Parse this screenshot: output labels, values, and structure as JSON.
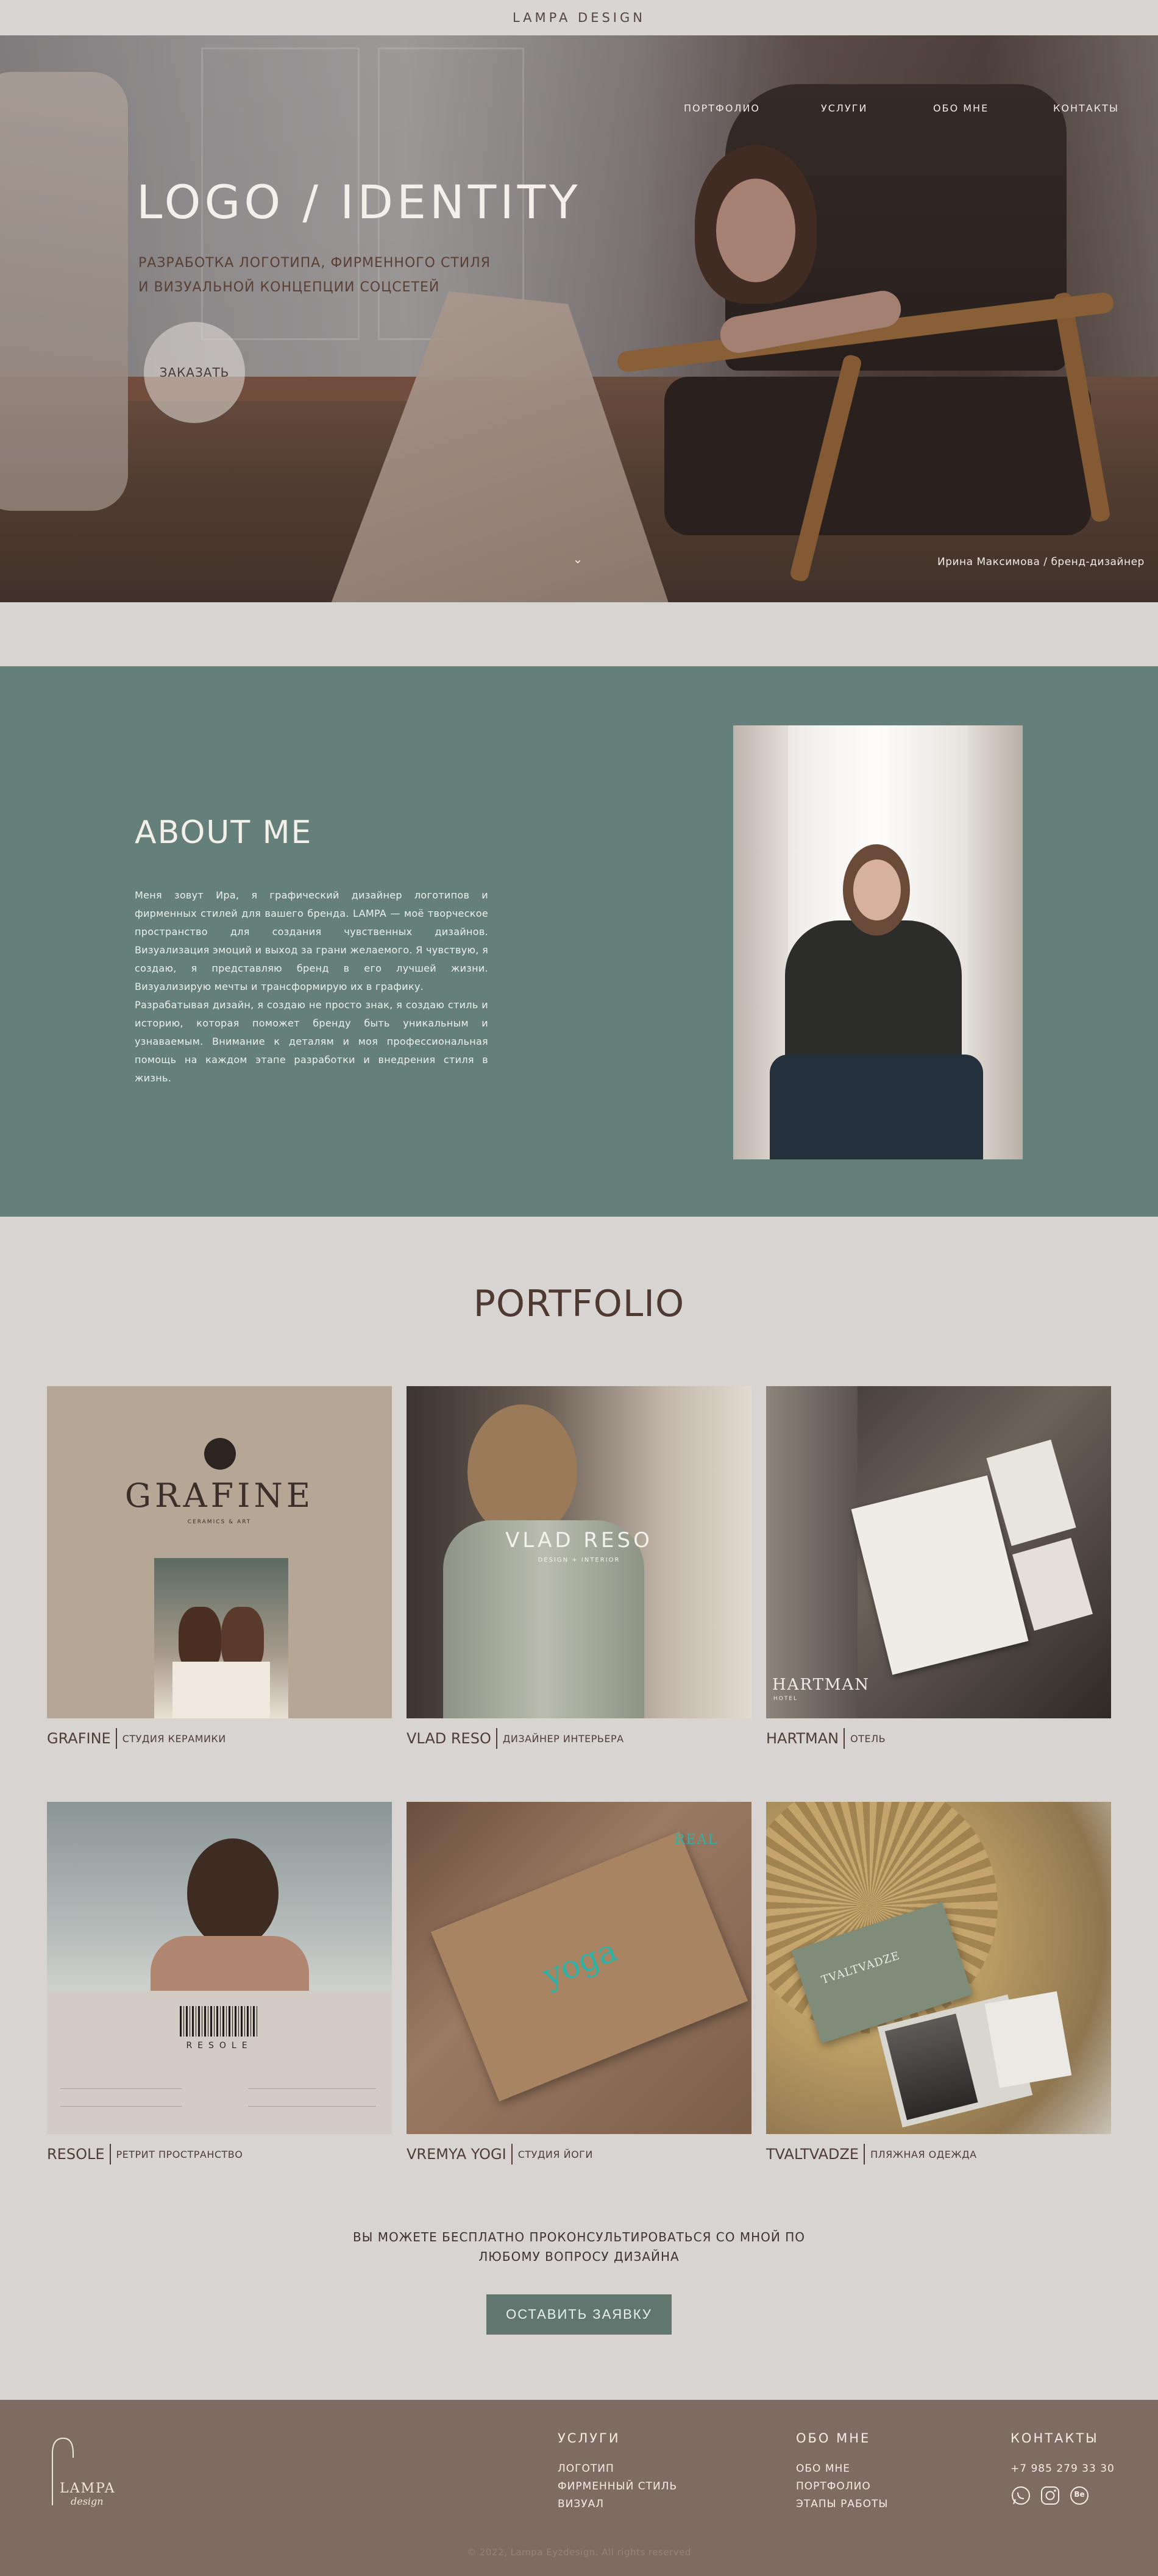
{
  "header": {
    "brand": "LAMPA DESIGN"
  },
  "nav": {
    "items": [
      "ПОРТФОЛИО",
      "УСЛУГИ",
      "ОБО МНЕ",
      "КОНТАКТЫ"
    ]
  },
  "hero": {
    "title": "LOGO / IDENTITY",
    "subtitle_line1": "РАЗРАБОТКА ЛОГОТИПА, ФИРМЕННОГО СТИЛЯ",
    "subtitle_line2": "И ВИЗУАЛЬНОЙ КОНЦЕПЦИИ СОЦСЕТЕЙ",
    "order_label": "ЗАКАЗАТЬ",
    "caption": "Ирина Максимова / бренд-дизайнер"
  },
  "about": {
    "title": "ABOUT ME",
    "paragraph1": "Меня зовут Ира, я графический дизайнер логотипов и фирменных стилей для вашего бренда. LAMPA — моё творческое пространство для создания чувственных дизайнов. Визуализация эмоций и выход за грани желаемого. Я чувствую, я создаю, я представляю бренд в его лучшей жизни. Визуализирую мечты и трансформирую их в графику.",
    "paragraph2": "Разрабатывая дизайн, я создаю не просто знак, я создаю стиль и историю, которая поможет бренду быть уникальным и узнаваемым. Внимание к деталям и моя профессиональная помощь на каждом этапе разработки и внедрения стиля в жизнь."
  },
  "portfolio": {
    "title": "PORTFOLIO",
    "items": [
      {
        "name": "GRAFINE",
        "desc": "СТУДИЯ КЕРАМИКИ",
        "img_text": "GRAFINE",
        "img_sub": "CERAMICS & ART"
      },
      {
        "name": "VLAD RESO",
        "desc": "ДИЗАЙНЕР ИНТЕРЬЕРА",
        "img_text": "VLAD RESO",
        "img_sub": "DESIGN + INTERIOR"
      },
      {
        "name": "HARTMAN",
        "desc": "ОТЕЛЬ",
        "img_text": "HARTMAN",
        "img_sub": "HOTEL"
      },
      {
        "name": "RESOLE",
        "desc": "РЕТРИТ ПРОСТРАНСТВО",
        "img_text": "RESOLE",
        "img_sub": ""
      },
      {
        "name": "VREMYA YOGI",
        "desc": "СТУДИЯ ЙОГИ",
        "img_text": "yoga",
        "img_sub": "REAL"
      },
      {
        "name": "TVALTVADZE",
        "desc": "ПЛЯЖНАЯ ОДЕЖДА",
        "img_text": "TVALTVADZE",
        "img_sub": ""
      }
    ]
  },
  "cta": {
    "line1": "ВЫ МОЖЕТЕ БЕСПЛАТНО ПРОКОНСУЛЬТИРОВАТЬСЯ СО МНОЙ ПО",
    "line2": "ЛЮБОМУ ВОПРОСУ ДИЗАЙНА",
    "button": "ОСТАВИТЬ ЗАЯВКУ"
  },
  "footer": {
    "logo_text": "LAMPA",
    "logo_script": "design",
    "services_title": "УСЛУГИ",
    "services": [
      "ЛОГОТИП",
      "ФИРМЕННЫЙ СТИЛЬ",
      "ВИЗУАЛ"
    ],
    "about_title": "ОБО МНЕ",
    "about_links": [
      "ОБО МНЕ",
      "ПОРТФОЛИО",
      "ЭТАПЫ РАБОТЫ"
    ],
    "contacts_title": "КОНТАКТЫ",
    "phone": "+7 985 279 33 30",
    "social": [
      "whatsapp-icon",
      "instagram-icon",
      "behance-icon"
    ],
    "social_behance": "Be",
    "copyright": "© 2022, Lampa Eyzdesign. All rights reserved"
  },
  "colors": {
    "about_bg": "#65807b",
    "footer_bg": "#7e6b61",
    "cta_button": "#61766f",
    "page_bg": "#d8d4d1"
  }
}
